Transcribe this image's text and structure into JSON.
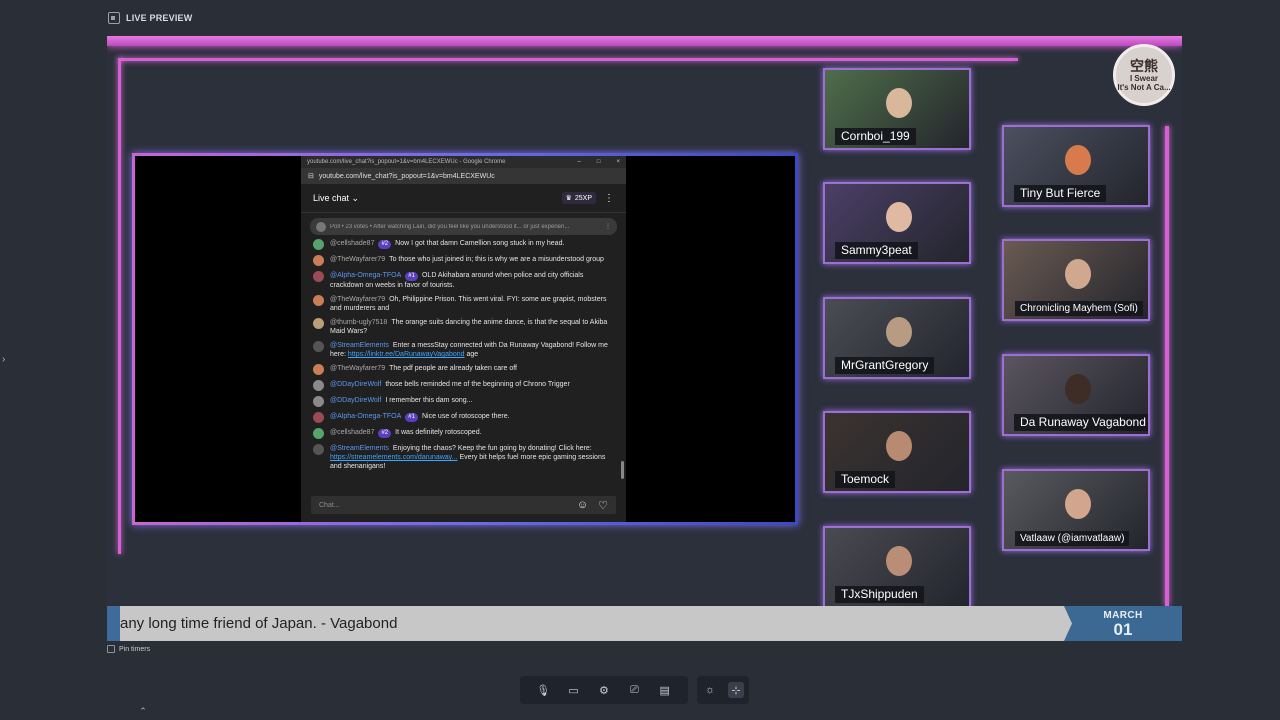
{
  "topbar": {
    "title": "LIVE PREVIEW"
  },
  "logo": {
    "text_line1": "空熊",
    "text_line2": "I Swear",
    "text_line3": "It's Not A Ca..."
  },
  "chat": {
    "window_title": "youtube.com/live_chat?is_popout=1&v=bm4LECXEWUc - Google Chrome",
    "url": "youtube.com/live_chat?is_popout=1&v=bm4LECXEWUc",
    "header_label": "Live chat",
    "xp": "25XP",
    "poll": "Poll • 23 votes • After watching Lain, did you feel like you understood it... or just experien...",
    "input_placeholder": "Chat...",
    "messages": [
      {
        "user": "@cellshade87",
        "badge": "#2",
        "text": "Now I got that damn Camellion song stuck in my head.",
        "color": "#56a36b",
        "mod": false
      },
      {
        "user": "@TheWayfarer79",
        "badge": "",
        "text": "To those who just joined in; this is why we are a misunderstood group",
        "color": "#c97e58",
        "mod": false
      },
      {
        "user": "@Alpha-Omega-TFOA",
        "badge": "#1",
        "text": "OLD Akihabara around when police and city officials crackdown on weebs in favor of tourists.",
        "color": "#9a4b56",
        "mod": true
      },
      {
        "user": "@TheWayfarer79",
        "badge": "",
        "text": "Oh, Philippine Prison. This went viral. FYI: some are grapist, mobsters and murderers and",
        "color": "#c97e58",
        "mod": false
      },
      {
        "user": "@thumb-ugly7518",
        "badge": "",
        "text": "The orange suits dancing the anime dance, is that the sequal to Akiba Maid Wars?",
        "color": "#b8a07a",
        "mod": false
      },
      {
        "user": "@StreamElements",
        "badge": "",
        "text": "Enter a messStay connected with Da Runaway Vagabond! Follow me here:",
        "link": "https://linktr.ee/DaRunawayVagabond",
        "tail": "age",
        "color": "#555555",
        "mod": true
      },
      {
        "user": "@TheWayfarer79",
        "badge": "",
        "text": "The pdf people are already taken care off",
        "color": "#c97e58",
        "mod": false
      },
      {
        "user": "@DDayDireWolf",
        "badge": "",
        "text": "those bells reminded me of the beginning of Chrono Trigger",
        "color": "#8a8a8a",
        "mod": true
      },
      {
        "user": "@DDayDireWolf",
        "badge": "",
        "text": "I remember this dam song...",
        "color": "#8a8a8a",
        "mod": true
      },
      {
        "user": "@Alpha-Omega-TFOA",
        "badge": "#1",
        "text": "Nice use of rotoscope there.",
        "color": "#9a4b56",
        "mod": true
      },
      {
        "user": "@cellshade87",
        "badge": "#2",
        "text": "It was definitely rotoscoped.",
        "color": "#56a36b",
        "mod": false
      },
      {
        "user": "@StreamElements",
        "badge": "",
        "text": "Enjoying the chaos? Keep the fun going by donating! Click here:",
        "link": "https://streamelements.com/darunaway...",
        "tail": "Every bit helps fuel more epic gaming sessions and shenanigans!",
        "color": "#555555",
        "mod": true
      }
    ]
  },
  "participants": [
    {
      "name": "Cornboi_199",
      "bg": "#4f6e4a",
      "face": "#d9b79a"
    },
    {
      "name": "Sammy3peat",
      "bg": "#4b3f67",
      "face": "#e0b9a2"
    },
    {
      "name": "MrGrantGregory",
      "bg": "#4a4d55",
      "face": "#b79b83"
    },
    {
      "name": "Toemock",
      "bg": "#3b3330",
      "face": "#b88a72"
    },
    {
      "name": "TJxShippuden",
      "bg": "#4a4a52",
      "face": "#b98d76"
    },
    {
      "name": "Tiny But Fierce",
      "bg": "#4b5060",
      "face": "#d87b4c"
    },
    {
      "name": "Chronicling Mayhem (Sofi)",
      "bg": "#6a5a52",
      "face": "#d0a890"
    },
    {
      "name": "Da Runaway Vagabond",
      "bg": "#5a5560",
      "face": "#3e2c26"
    },
    {
      "name": "Vatlaaw (@iamvatlaaw)",
      "bg": "#585a5f",
      "face": "#d2a58e"
    }
  ],
  "ticker": {
    "text": "any long time friend of Japan. - Vagabond",
    "month": "MARCH",
    "day": "01"
  },
  "pin": {
    "label": "Pin timers"
  },
  "icons": [
    "microphone-icon",
    "camera-icon",
    "settings-icon",
    "share-screen-icon",
    "layout-icon",
    "brightness-icon",
    "focus-icon"
  ]
}
